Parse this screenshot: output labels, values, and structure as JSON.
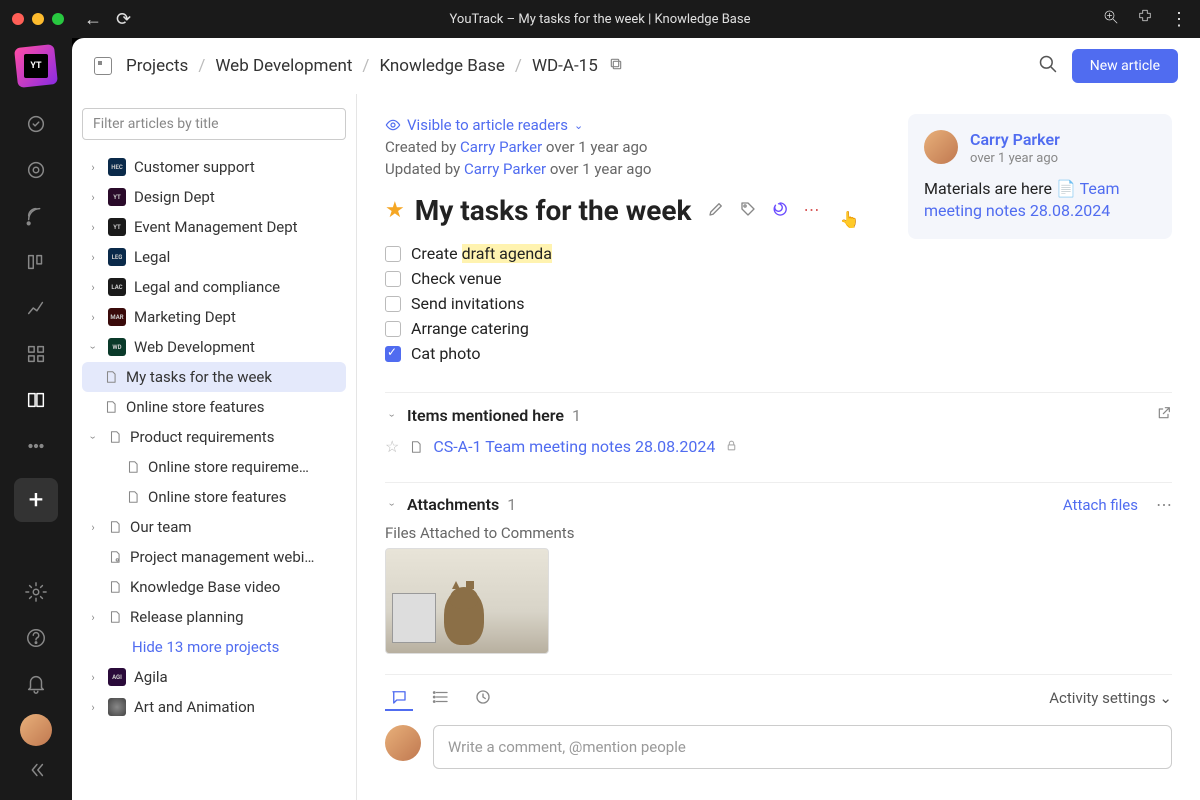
{
  "window": {
    "title": "YouTrack – My tasks for the week | Knowledge Base"
  },
  "breadcrumb": {
    "projects": "Projects",
    "project": "Web Development",
    "kb": "Knowledge Base",
    "id": "WD-A-15"
  },
  "topbar": {
    "new_article": "New article"
  },
  "sidebar": {
    "filter_placeholder": "Filter articles by title",
    "hide_more": "Hide 13 more projects",
    "items": [
      {
        "label": "Customer support",
        "badge": "HEC",
        "bg": "#0a2a4a"
      },
      {
        "label": "Design Dept",
        "badge": "YT",
        "bg": "#2a0a2a"
      },
      {
        "label": "Event Management Dept",
        "badge": "YT",
        "bg": "#1a1a1a"
      },
      {
        "label": "Legal",
        "badge": "LEG",
        "bg": "#0a2a4a"
      },
      {
        "label": "Legal and compliance",
        "badge": "LAC",
        "bg": "#1a1a1a"
      },
      {
        "label": "Marketing Dept",
        "badge": "MAR",
        "bg": "#3a0a0a"
      },
      {
        "label": "Web Development",
        "badge": "WD",
        "bg": "#0a3a2a"
      }
    ],
    "wd_children": [
      "My tasks for the week",
      "Online store features"
    ],
    "prod_req": "Product requirements",
    "prod_children": [
      "Online store requireme…",
      "Online store features"
    ],
    "our_team": "Our team",
    "pmw": "Project management webi…",
    "kbv": "Knowledge Base video",
    "rel": "Release planning",
    "agila": "Agila",
    "art": "Art and Animation"
  },
  "article": {
    "visibility": "Visible to article readers",
    "created_label": "Created by ",
    "updated_label": "Updated by ",
    "author": "Carry Parker",
    "updater": "Carry Parker",
    "created_ago": " over 1 year ago",
    "updated_ago": " over 1 year ago",
    "title": "My tasks for the week",
    "checklist": [
      {
        "text_pre": "Create ",
        "hl": "draft agenda",
        "checked": false
      },
      {
        "text": "Check venue",
        "checked": false
      },
      {
        "text": "Send invitations",
        "checked": false
      },
      {
        "text": "Arrange catering",
        "checked": false
      },
      {
        "text": "Cat photo",
        "checked": true
      }
    ],
    "mentions": {
      "header": "Items mentioned here",
      "count": "1",
      "link": "CS-A-1 Team meeting notes 28.08.2024"
    },
    "attachments": {
      "header": "Attachments",
      "count": "1",
      "attach_files": "Attach files",
      "files_label": "Files Attached to Comments"
    },
    "activity": {
      "settings": "Activity settings"
    },
    "comment_placeholder": "Write a comment, @mention people"
  },
  "sidecard": {
    "author": "Carry Parker",
    "time": "over 1 year ago",
    "text_pre": "Materials are here ",
    "link": "Team meeting notes 28.08.2024"
  }
}
